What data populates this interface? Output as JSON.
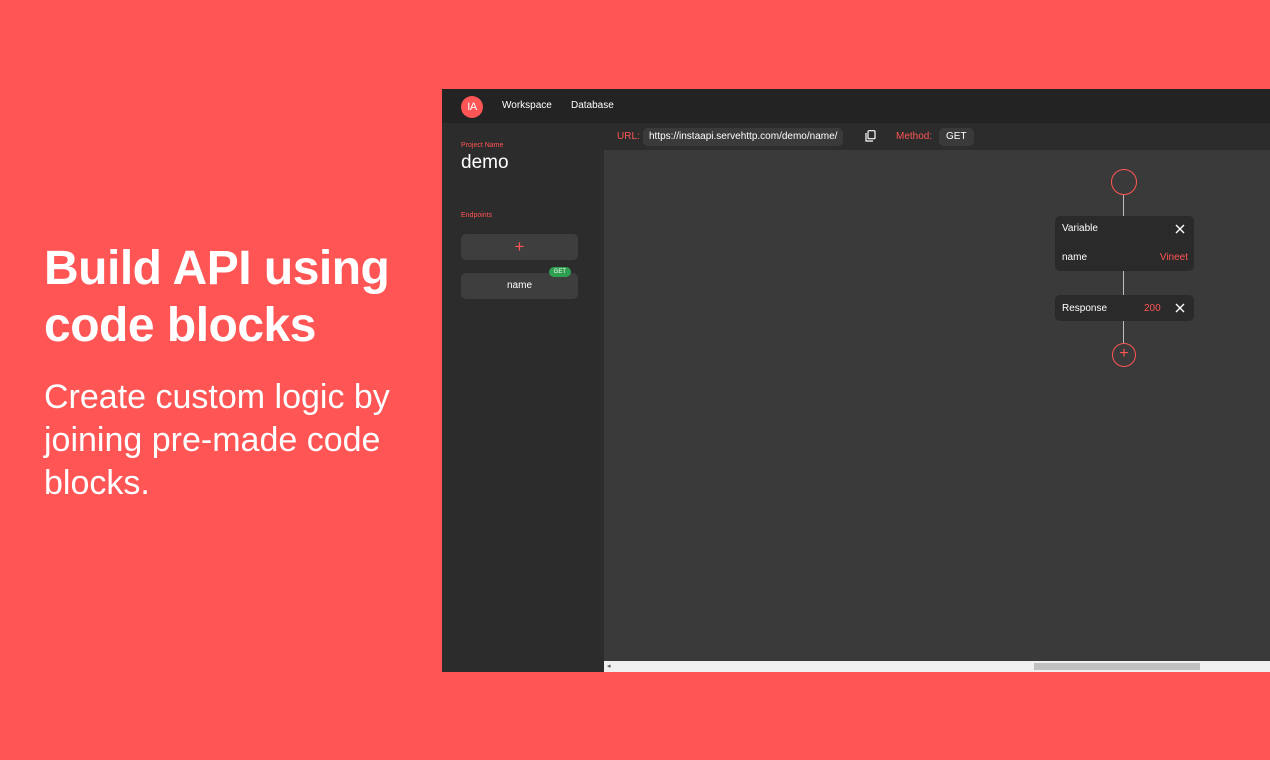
{
  "hero": {
    "title_line1": "Build API using",
    "title_line2": "code blocks",
    "subtitle_line1": "Create custom logic by",
    "subtitle_line2": "joining pre-made code",
    "subtitle_line3": "blocks."
  },
  "app": {
    "logo_text": "IA",
    "nav": {
      "workspace": "Workspace",
      "database": "Database"
    },
    "sidebar": {
      "project_label": "Project Name",
      "project_name": "demo",
      "endpoints_label": "Endpoints",
      "add_button": "+",
      "endpoints": [
        {
          "name": "name",
          "method": "GET"
        }
      ]
    },
    "urlbar": {
      "url_label": "URL:",
      "url_value": "https://instaapi.servehttp.com/demo/name/",
      "method_label": "Method:",
      "method_value": "GET"
    },
    "canvas": {
      "variable_block": {
        "title": "Variable",
        "key": "name",
        "value": "Vineet"
      },
      "response_block": {
        "title": "Response",
        "status": "200"
      },
      "add_node": "+"
    }
  },
  "colors": {
    "brand": "#ff5555",
    "topbar_bg": "#232323",
    "sidebar_bg": "#2c2c2c",
    "canvas_bg": "#3a3a3a",
    "get_badge": "#2e9e4f"
  },
  "icons": [
    "copy-icon",
    "close-icon",
    "plus-icon",
    "scroll-left-arrow-icon"
  ]
}
